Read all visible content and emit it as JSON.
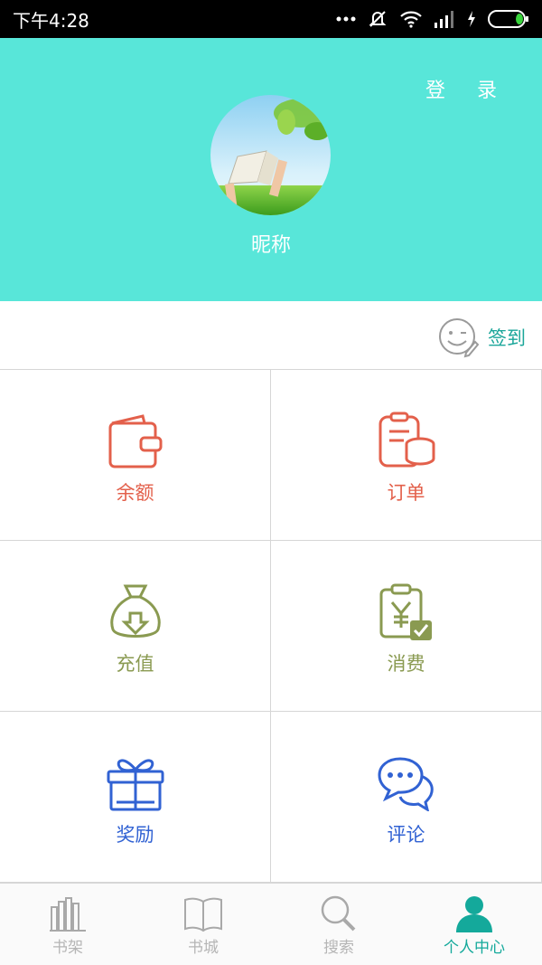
{
  "status_bar": {
    "time": "下午4:28"
  },
  "header": {
    "login_label": "登 录",
    "nickname": "昵称"
  },
  "signin": {
    "label": "签到"
  },
  "grid": [
    {
      "label": "余额",
      "icon": "wallet-icon",
      "color": "#e3604b"
    },
    {
      "label": "订单",
      "icon": "order-coins-icon",
      "color": "#e3604b"
    },
    {
      "label": "充值",
      "icon": "money-bag-icon",
      "color": "#8a9a51"
    },
    {
      "label": "消费",
      "icon": "consumption-clipboard-icon",
      "color": "#8a9a51"
    },
    {
      "label": "奖励",
      "icon": "gift-icon",
      "color": "#3162d3"
    },
    {
      "label": "评论",
      "icon": "chat-bubbles-icon",
      "color": "#3162d3"
    }
  ],
  "tabs": [
    {
      "label": "书架",
      "icon": "bookshelf-icon",
      "active": false
    },
    {
      "label": "书城",
      "icon": "open-book-icon",
      "active": false
    },
    {
      "label": "搜索",
      "icon": "search-icon",
      "active": false
    },
    {
      "label": "个人中心",
      "icon": "person-icon",
      "active": true
    }
  ],
  "colors": {
    "header_bg": "#58e6d9",
    "accent": "#14a99b"
  }
}
